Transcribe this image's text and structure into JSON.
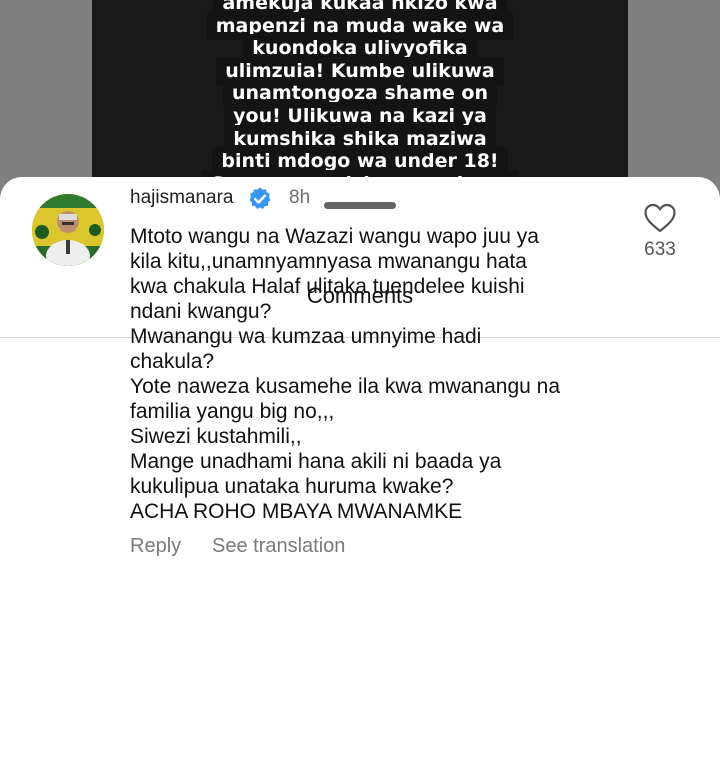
{
  "background_video": {
    "caption_lines": [
      "amekuja kukaa nkizo kwa",
      "mapenzi na muda wake wa",
      "kuondoka ulivyofika",
      "ulimzuia! Kumbe ulikuwa",
      "unamtongoza shame on",
      "you! Ulikuwa na kazi ya",
      "kumshika shika maziwa",
      "binti mdogo wa under 18!",
      "Sasa unaanzisha upumbavu"
    ]
  },
  "sheet": {
    "title": "Comments"
  },
  "comment": {
    "username": "hajismanara",
    "verified": true,
    "timestamp": "8h",
    "text_lines": [
      "Mtoto wangu na Wazazi wangu wapo juu ya",
      "kila kitu,,unamnyamnyasa mwanangu hata",
      "kwa chakula Halaf ulitaka tuendelee kuishi",
      "ndani kwangu?",
      "Mwanangu wa kumzaa umnyime hadi",
      "chakula?",
      "Yote naweza kusamehe ila kwa mwanangu na",
      "familia yangu big no,,,",
      "Siwezi kustahmili,,",
      "Mange unadhami hana akili ni baada ya",
      "kukulipua unataka huruma kwake?",
      "ACHA ROHO MBAYA MWANAMKE"
    ],
    "like_count": "633",
    "reply_label": "Reply",
    "translation_label": "See translation"
  },
  "colors": {
    "verified_badge": "#3797f0",
    "sheet_background": "#ffffff",
    "dim_backdrop": "#7f7f7f"
  },
  "icons": {
    "verified": "verified-badge-icon",
    "like": "heart-outline-icon"
  }
}
